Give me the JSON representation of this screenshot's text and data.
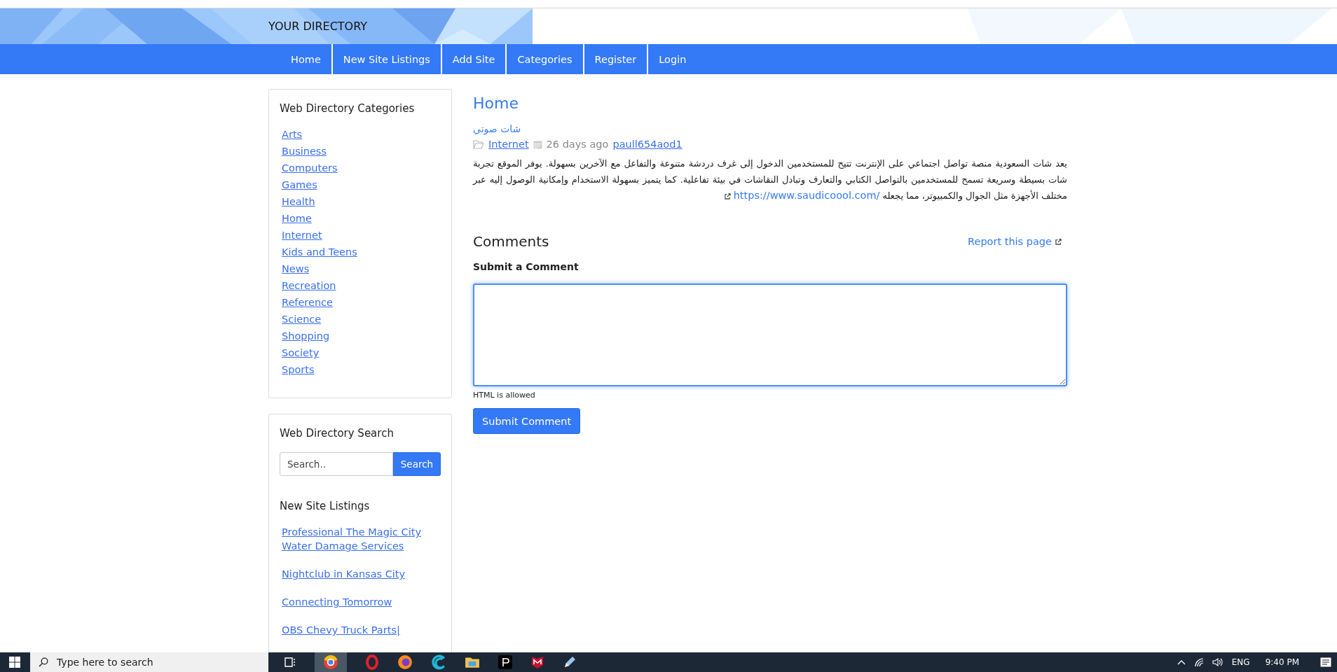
{
  "site_title": "YOUR DIRECTORY",
  "nav": [
    {
      "label": "Home"
    },
    {
      "label": "New Site Listings"
    },
    {
      "label": "Add Site"
    },
    {
      "label": "Categories"
    },
    {
      "label": "Register"
    },
    {
      "label": "Login"
    }
  ],
  "sidebar": {
    "categories": {
      "title": "Web Directory Categories",
      "items": [
        "Arts",
        "Business",
        "Computers",
        "Games",
        "Health",
        "Home",
        "Internet",
        "Kids and Teens",
        "News",
        "Recreation",
        "Reference",
        "Science",
        "Shopping",
        "Society",
        "Sports"
      ]
    },
    "search": {
      "title": "Web Directory Search",
      "placeholder": "Search..",
      "button": "Search"
    },
    "new_listings": {
      "title": "New Site Listings",
      "items": [
        "Professional The Magic City Water Damage Services",
        "Nightclub in Kansas City",
        "Connecting Tomorrow",
        "OBS Chevy Truck Parts|"
      ]
    }
  },
  "main": {
    "heading": "Home",
    "listing": {
      "title": "شات صوتي",
      "category": "Internet",
      "age": "26 days ago",
      "user": "paull654aod1",
      "description": "يعد شات السعودية منصة تواصل اجتماعي على الإنترنت تتيح للمستخدمين الدخول إلى غرف دردشة متنوعة والتفاعل مع الآخرين بسهولة. يوفر الموقع تجربة شات بسيطة وسريعة تسمح للمستخدمين بالتواصل الكتابي والتعارف وتبادل النقاشات في بيئة تفاعلية. كما يتميز بسهولة الاستخدام وإمكانية الوصول إليه عبر مختلف الأجهزة مثل الجوال والكمبيوتر، مما يجعله",
      "url": "https://www.saudicoool.com/"
    },
    "comments": {
      "title": "Comments",
      "report": "Report this page",
      "form_title": "Submit a Comment",
      "hint": "HTML is allowed",
      "button": "Submit Comment"
    }
  },
  "taskbar": {
    "search_placeholder": "Type here to search",
    "language": "ENG",
    "time": "9:40 PM"
  }
}
